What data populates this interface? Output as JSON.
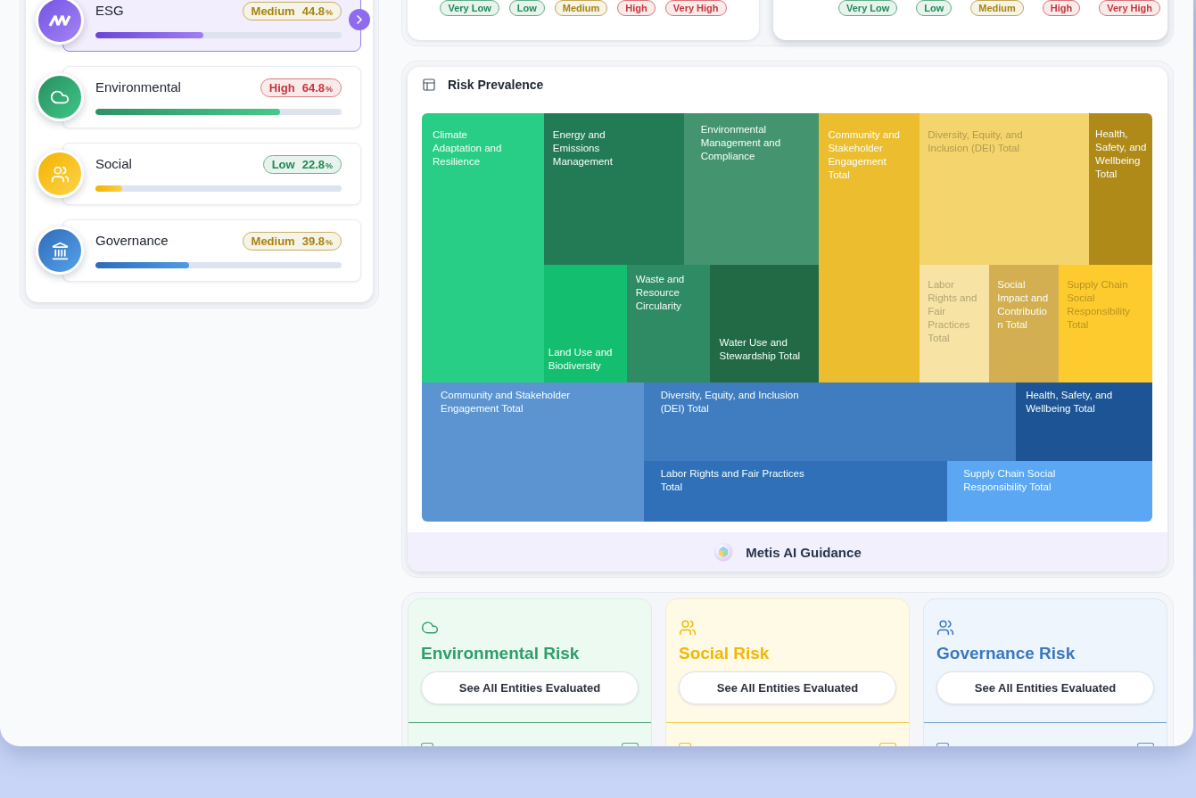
{
  "summary_panel": {
    "rows": [
      {
        "kind": "esg",
        "title": "ESG",
        "selected": true,
        "rating": {
          "label": "Medium",
          "score": "44.8",
          "unit": "%",
          "color": "#a88310"
        },
        "level": 0.44
      },
      {
        "kind": "environmental",
        "title": "Environmental",
        "selected": false,
        "rating": {
          "label": "High",
          "score": "64.8",
          "unit": "%",
          "color": "#c8353b"
        },
        "level": 0.75
      },
      {
        "kind": "social",
        "title": "Social",
        "selected": false,
        "rating": {
          "label": "Low",
          "score": "22.8",
          "unit": "%",
          "color": "#1e8a55"
        },
        "level": 0.11
      },
      {
        "kind": "governance",
        "title": "Governance",
        "selected": false,
        "rating": {
          "label": "Medium",
          "score": "39.8",
          "unit": "%",
          "color": "#a88310"
        },
        "level": 0.38
      }
    ]
  },
  "legend_cards": [
    {
      "items": [
        {
          "label": "Very Low",
          "color": "#1e8a55"
        },
        {
          "label": "Low",
          "color": "#1e8a55"
        },
        {
          "label": "Medium",
          "color": "#a88310"
        },
        {
          "label": "High",
          "color": "#c8353b"
        },
        {
          "label": "Very High",
          "color": "#c8353b"
        }
      ]
    },
    {
      "items": [
        {
          "label": "Very Low",
          "color": "#1e8a55"
        },
        {
          "label": "Low",
          "color": "#1e8a55"
        },
        {
          "label": "Medium",
          "color": "#a88310"
        },
        {
          "label": "High",
          "color": "#c8353b"
        },
        {
          "label": "Very High",
          "color": "#c8353b"
        }
      ]
    }
  ],
  "risk_prevalence": {
    "title": "Risk Prevalence",
    "treemap": {
      "cells": [
        {
          "label": "Climate Adaptation and Resilience",
          "color": "#28cd86"
        },
        {
          "label": "Energy and Emissions Management",
          "color": "#237b55"
        },
        {
          "label": "Environmental Management and Compliance",
          "color": "#44956f"
        },
        {
          "label": "Land Use and Biodiversity",
          "color": "#13be6f"
        },
        {
          "label": "Waste and Resource Circularity",
          "color": "#2e8b63"
        },
        {
          "label": "Water Use and Stewardship Total",
          "color": "#226a45"
        },
        {
          "label": "Community and Stakeholder Engagement Total",
          "color": "#ecbe2f"
        },
        {
          "label": "Diversity, Equity, and Inclusion (DEI) Total",
          "color": "#f4d56d"
        },
        {
          "label": "Health, Safety, and Wellbeing Total",
          "color": "#b08a18"
        },
        {
          "label": "Labor Rights and Fair Practices Total",
          "color": "#f7e4a4"
        },
        {
          "label": "Social Impact and Contribution Total",
          "color": "#d4af51"
        },
        {
          "label": "Supply Chain Social Responsibility Total",
          "color": "#fecb2f"
        },
        {
          "label": "Community and Stakeholder Engagement Total",
          "color": "#5c94d2"
        },
        {
          "label": "Diversity, Equity, and Inclusion (DEI) Total",
          "color": "#3f7cc0"
        },
        {
          "label": "Health, Safety, and Wellbeing Total",
          "color": "#1c5495"
        },
        {
          "label": "Labor Rights and Fair Practices Total",
          "color": "#2f70b9"
        },
        {
          "label": "Supply Chain Social Responsibility Total",
          "color": "#5ba7f3"
        }
      ]
    },
    "guidance_button": "Metis AI Guidance"
  },
  "risk_cards": [
    {
      "kind": "environmental",
      "title": "Environmental Risk",
      "button": "See All Entities Evaluated"
    },
    {
      "kind": "social",
      "title": "Social Risk",
      "button": "See All Entities Evaluated"
    },
    {
      "kind": "governance",
      "title": "Governance Risk",
      "button": "See All Entities Evaluated"
    }
  ]
}
